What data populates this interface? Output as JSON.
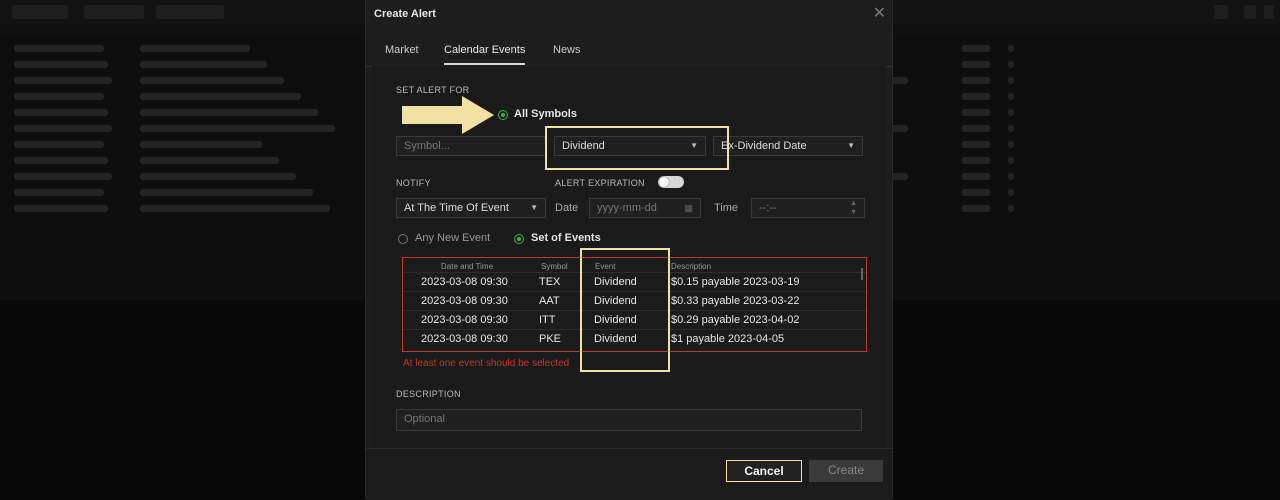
{
  "dialog": {
    "title": "Create Alert",
    "close_glyph": "✕",
    "tabs": [
      {
        "label": "Market",
        "active": false
      },
      {
        "label": "Calendar Events",
        "active": true
      },
      {
        "label": "News",
        "active": false
      }
    ]
  },
  "set_alert_for": {
    "label": "SET ALERT FOR",
    "all_symbols_label": "All Symbols",
    "symbol_placeholder": "Symbol...",
    "event_type": "Dividend",
    "date_type": "Ex-Dividend Date"
  },
  "notify": {
    "label": "NOTIFY",
    "value": "At The Time Of Event",
    "alert_expiration_label": "ALERT EXPIRATION",
    "alert_expiration_on": true,
    "date_label": "Date",
    "date_placeholder": "yyyy-mm-dd",
    "time_label": "Time",
    "time_placeholder": "--:--"
  },
  "event_scope": {
    "any_new_event_label": "Any New Event",
    "set_of_events_label": "Set of Events",
    "selected": "set_of_events"
  },
  "events_table": {
    "headers": [
      "Date and Time",
      "Symbol",
      "Event",
      "Description"
    ],
    "rows": [
      {
        "date_time": "2023-03-08 09:30",
        "symbol": "TEX",
        "event": "Dividend",
        "description": "$0.15 payable 2023-03-19"
      },
      {
        "date_time": "2023-03-08 09:30",
        "symbol": "AAT",
        "event": "Dividend",
        "description": "$0.33 payable 2023-03-22"
      },
      {
        "date_time": "2023-03-08 09:30",
        "symbol": "ITT",
        "event": "Dividend",
        "description": "$0.29 payable 2023-04-02"
      },
      {
        "date_time": "2023-03-08 09:30",
        "symbol": "PKE",
        "event": "Dividend",
        "description": "$1 payable 2023-04-05"
      }
    ],
    "error": "At least one event should be selected"
  },
  "description": {
    "label": "DESCRIPTION",
    "placeholder": "Optional"
  },
  "footer": {
    "cancel_label": "Cancel",
    "create_label": "Create"
  },
  "colors": {
    "accent_green": "#3cb44b",
    "error_red": "#c0392b",
    "highlight_yellow": "#f1e2a4"
  }
}
